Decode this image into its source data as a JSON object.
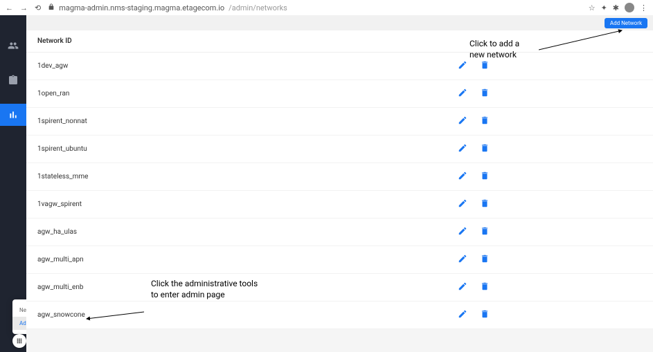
{
  "browser": {
    "url_host": "magma-admin.nms-staging.magma.etagecom.io",
    "url_path": "/admin/networks"
  },
  "actions": {
    "add_network": "Add Network"
  },
  "table": {
    "header": "Network ID",
    "rows": [
      {
        "name": "1dev_agw"
      },
      {
        "name": "1open_ran"
      },
      {
        "name": "1spirent_nonnat"
      },
      {
        "name": "1spirent_ubuntu"
      },
      {
        "name": "1stateless_mme"
      },
      {
        "name": "1vagw_spirent"
      },
      {
        "name": "agw_ha_ulas"
      },
      {
        "name": "agw_multi_apn"
      },
      {
        "name": "agw_multi_enb"
      },
      {
        "name": "agw_snowcone"
      }
    ]
  },
  "popup": {
    "item1": "Network Management",
    "item2": "Administrative Tools"
  },
  "annotations": {
    "admin_tools": "Click the administrative tools to enter admin page",
    "add_net": "Click to add a new network"
  }
}
